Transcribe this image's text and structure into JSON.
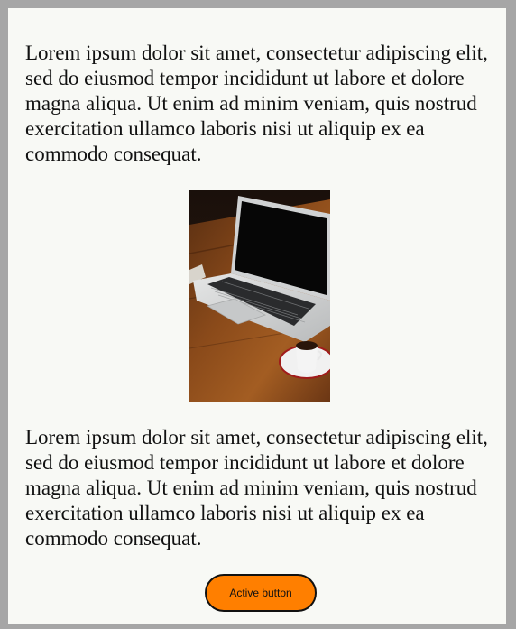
{
  "content": {
    "paragraph_1": "Lorem ipsum dolor sit amet, consectetur adipiscing elit, sed do eiusmod tempor incididunt ut labore et dolore magna aliqua. Ut enim ad minim veniam, quis nostrud exercitation ullamco laboris nisi ut aliquip ex ea commodo consequat.",
    "paragraph_2": "Lorem ipsum dolor sit amet, consectetur adipiscing elit, sed do eiusmod tempor incididunt ut labore et dolore magna aliqua. Ut enim ad minim veniam, quis nostrud exercitation ullamco laboris nisi ut aliquip ex ea commodo consequat.",
    "image": {
      "subject": "laptop-and-coffee-cup-on-wooden-table"
    },
    "button": {
      "label": "Active button",
      "color": "#ff7f00"
    }
  },
  "colors": {
    "page_background": "#a6a6a6",
    "card_background": "#f8f9f5",
    "text": "#111111"
  }
}
